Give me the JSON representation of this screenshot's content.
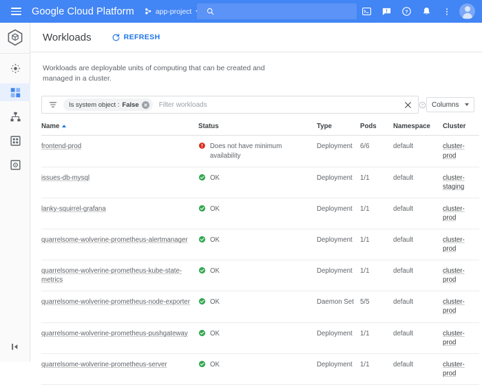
{
  "header": {
    "brand": "Google Cloud Platform",
    "menu_icon": "hamburger-icon",
    "project": "app-project",
    "search_placeholder": "",
    "icons": [
      "cloud-shell-icon",
      "feedback-icon",
      "help-icon",
      "notifications-icon",
      "more-options-icon",
      "avatar"
    ]
  },
  "rail": {
    "logo": "kubernetes-engine-logo",
    "items": [
      {
        "name": "clusters",
        "icon": "clusters-icon",
        "selected": false
      },
      {
        "name": "workloads",
        "icon": "workloads-icon",
        "selected": true
      },
      {
        "name": "services",
        "icon": "services-icon",
        "selected": false
      },
      {
        "name": "applications",
        "icon": "applications-icon",
        "selected": false
      },
      {
        "name": "storage",
        "icon": "storage-icon",
        "selected": false
      }
    ],
    "expand_label": "expand-panel-icon"
  },
  "page": {
    "title": "Workloads",
    "refresh_label": "REFRESH",
    "description": "Workloads are deployable units of computing that can be created and managed in a cluster."
  },
  "filter": {
    "icon": "filter-icon",
    "chip_label": "Is system object :",
    "chip_value": "False",
    "chip_remove": "remove-chip-icon",
    "placeholder": "Filter workloads",
    "value": "",
    "clear_icon": "clear-filter-icon",
    "help_icon": "filter-help-icon",
    "columns_label": "Columns"
  },
  "table": {
    "columns": [
      "Name",
      "Status",
      "Type",
      "Pods",
      "Namespace",
      "Cluster"
    ],
    "sort_column": "Name",
    "sort_direction": "asc",
    "rows": [
      {
        "name": "frontend-prod",
        "status": "Does not have minimum availability",
        "status_kind": "error",
        "type": "Deployment",
        "pods": "6/6",
        "namespace": "default",
        "cluster": "cluster-prod"
      },
      {
        "name": "issues-db-mysql",
        "status": "OK",
        "status_kind": "ok",
        "type": "Deployment",
        "pods": "1/1",
        "namespace": "default",
        "cluster": "cluster-staging"
      },
      {
        "name": "lanky-squirrel-grafana",
        "status": "OK",
        "status_kind": "ok",
        "type": "Deployment",
        "pods": "1/1",
        "namespace": "default",
        "cluster": "cluster-prod"
      },
      {
        "name": "quarrelsome-wolverine-prometheus-alertmanager",
        "status": "OK",
        "status_kind": "ok",
        "type": "Deployment",
        "pods": "1/1",
        "namespace": "default",
        "cluster": "cluster-prod"
      },
      {
        "name": "quarrelsome-wolverine-prometheus-kube-state-metrics",
        "status": "OK",
        "status_kind": "ok",
        "type": "Deployment",
        "pods": "1/1",
        "namespace": "default",
        "cluster": "cluster-prod"
      },
      {
        "name": "quarrelsome-wolverine-prometheus-node-exporter",
        "status": "OK",
        "status_kind": "ok",
        "type": "Daemon Set",
        "pods": "5/5",
        "namespace": "default",
        "cluster": "cluster-prod"
      },
      {
        "name": "quarrelsome-wolverine-prometheus-pushgateway",
        "status": "OK",
        "status_kind": "ok",
        "type": "Deployment",
        "pods": "1/1",
        "namespace": "default",
        "cluster": "cluster-prod"
      },
      {
        "name": "quarrelsome-wolverine-prometheus-server",
        "status": "OK",
        "status_kind": "ok",
        "type": "Deployment",
        "pods": "1/1",
        "namespace": "default",
        "cluster": "cluster-prod"
      }
    ]
  },
  "colors": {
    "header_blue": "#4285F4",
    "link_blue": "#1a73e8",
    "status_error": "#D93025",
    "status_ok": "#34A853",
    "selected_bg": "#e8f0fe"
  }
}
